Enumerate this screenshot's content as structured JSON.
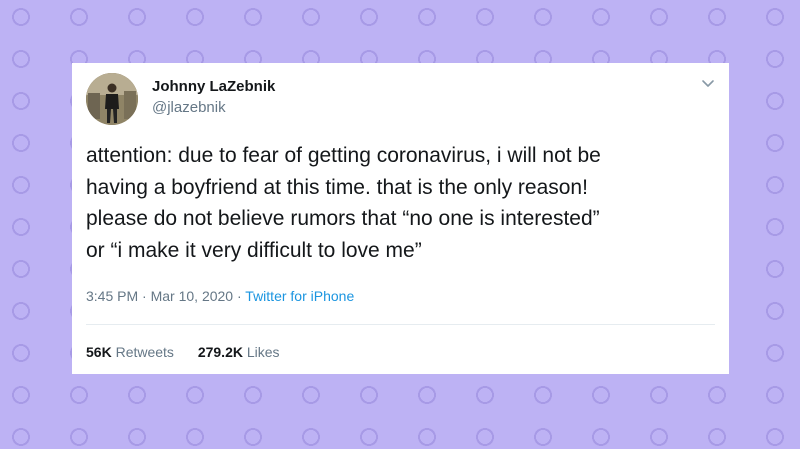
{
  "tweet": {
    "author_name": "Johnny LaZebnik",
    "handle": "@jlazebnik",
    "text_lines": [
      "attention: due to fear of getting coronavirus, i will not be",
      "having a boyfriend at this time. that is the only reason!",
      "please do not believe rumors that “no one is interested”",
      "or “i make it very difficult to love me”"
    ],
    "time": "3:45 PM",
    "date": "Mar 10, 2020",
    "separator": "·",
    "source": "Twitter for iPhone",
    "retweets_count": "56K",
    "retweets_label": "Retweets",
    "likes_count": "279.2K",
    "likes_label": "Likes"
  },
  "icons": {
    "menu": "chevron-down-icon",
    "avatar": "profile-photo"
  },
  "colors": {
    "background": "#bdb2f4",
    "dots": "#a79ae6",
    "link": "#1b95e0",
    "secondary_text": "#657786",
    "primary_text": "#14171a"
  }
}
